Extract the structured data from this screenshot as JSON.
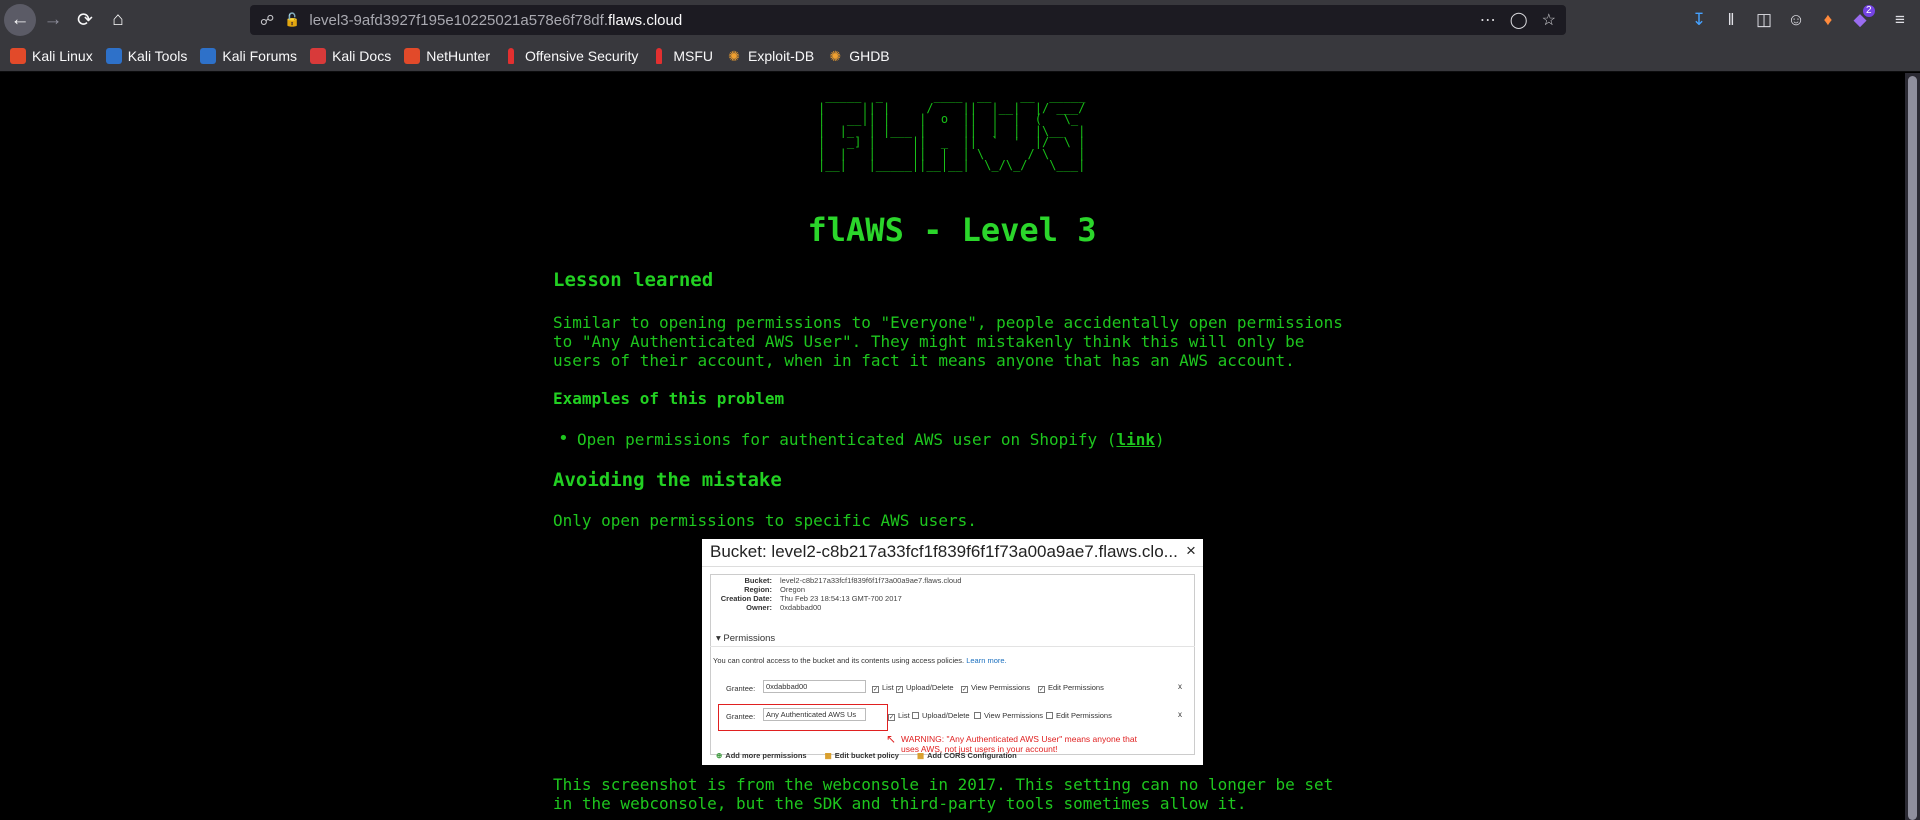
{
  "browser": {
    "url_prefix": "level3-9afd3927f195e10225021a578e6f78df.",
    "url_domain": "flaws.cloud",
    "downloads_badge": "2"
  },
  "bookmarks": [
    {
      "label": "Kali Linux",
      "icon": "kali-icon"
    },
    {
      "label": "Kali Tools",
      "icon": "kali-tools-icon"
    },
    {
      "label": "Kali Forums",
      "icon": "kali-forums-icon"
    },
    {
      "label": "Kali Docs",
      "icon": "kali-docs-icon"
    },
    {
      "label": "NetHunter",
      "icon": "nethunter-icon"
    },
    {
      "label": "Offensive Security",
      "icon": "offsec-icon"
    },
    {
      "label": "MSFU",
      "icon": "msfu-icon"
    },
    {
      "label": "Exploit-DB",
      "icon": "exploitdb-icon"
    },
    {
      "label": "GHDB",
      "icon": "ghdb-icon"
    }
  ],
  "page": {
    "ascii_logo": " _____  _       ____  __    __  _____\n|     || |     /    ||  |__|  |/ ___/\n|   __|| |    |  o  ||  |  |  (   \\_ \n|  |_  | |___ |     ||  |  |  |\\__  |\n|   _] |     ||  _  ||  `  '  |/  \\ |\n|  |   |     ||  |  | \\      / \\    |\n|__|   |_____||__|__|  \\_/\\_/   \\___|",
    "title": "flAWS - Level 3",
    "lesson_heading": "Lesson learned",
    "lesson_text": "Similar to opening permissions to \"Everyone\", people accidentally open permissions\nto \"Any Authenticated AWS User\". They might mistakenly think this will only be\nusers of their account, when in fact it means anyone that has an AWS account.",
    "examples_heading": "Examples of this problem",
    "example_item": "Open permissions for authenticated AWS user on Shopify (",
    "example_link": "link",
    "example_close": ")",
    "avoid_heading": "Avoiding the mistake",
    "avoid_text": "Only open permissions to specific AWS users.",
    "footer_text": "This screenshot is from the webconsole in 2017. This setting can no longer be set\nin the webconsole, but the SDK and third-party tools sometimes allow it."
  },
  "console_shot": {
    "header": "Bucket: level2-c8b217a33fcf1f839f6f1f73a00a9ae7.flaws.clo...",
    "close": "×",
    "bucket_label": "Bucket:",
    "bucket_value": "level2-c8b217a33fcf1f839f6f1f73a00a9ae7.flaws.cloud",
    "region_label": "Region:",
    "region_value": "Oregon",
    "created_label": "Creation Date:",
    "created_value": "Thu Feb 23 18:54:13 GMT-700 2017",
    "owner_label": "Owner:",
    "owner_value": "0xdabbad00",
    "permissions": "Permissions",
    "perm_desc": "You can control access to the bucket and its contents using access policies.",
    "learn_more": "Learn more.",
    "grantee_label": "Grantee:",
    "grantee1": "0xdabbad00",
    "grantee2": "Any Authenticated AWS Us",
    "list": "List",
    "upload_delete": "Upload/Delete",
    "view_permissions": "View Permissions",
    "edit_permissions": "Edit Permissions",
    "row_x": "x",
    "warning": "WARNING: \"Any Authenticated AWS User\" means anyone that\nuses AWS, not just users in your account!",
    "add_more": "Add more permissions",
    "edit_policy": "Edit bucket policy",
    "add_cors": "Add CORS Configuration"
  }
}
